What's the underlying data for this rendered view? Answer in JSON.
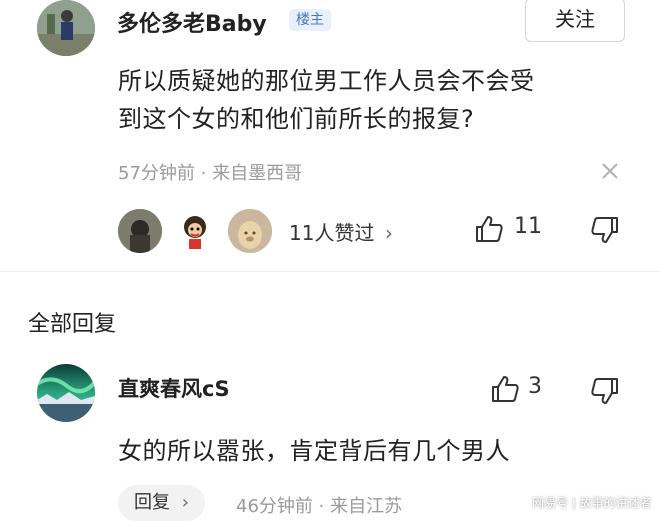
{
  "post": {
    "author": "多伦多老Baby",
    "badge": "楼主",
    "follow_label": "关注",
    "content_line1": "所以质疑她的那位男工作人员会不会受",
    "content_line2": "到这个女的和他们前所长的报复?",
    "meta": "57分钟前 · 来自墨西哥",
    "likers_text": "11人赞过",
    "likers_chevron": "›",
    "like_count": "11"
  },
  "section": {
    "title": "全部回复"
  },
  "reply": {
    "author": "直爽春风cS",
    "like_count": "3",
    "content": "女的所以嚣张，肯定背后有几个男人",
    "reply_button": "回复",
    "reply_chevron": "›",
    "meta": "46分钟前 · 来自江苏"
  },
  "watermark": "网易号 | 故事的讲述者",
  "icons": {
    "like": "thumbs-up-icon",
    "dislike": "thumbs-down-icon",
    "close": "close-icon"
  }
}
